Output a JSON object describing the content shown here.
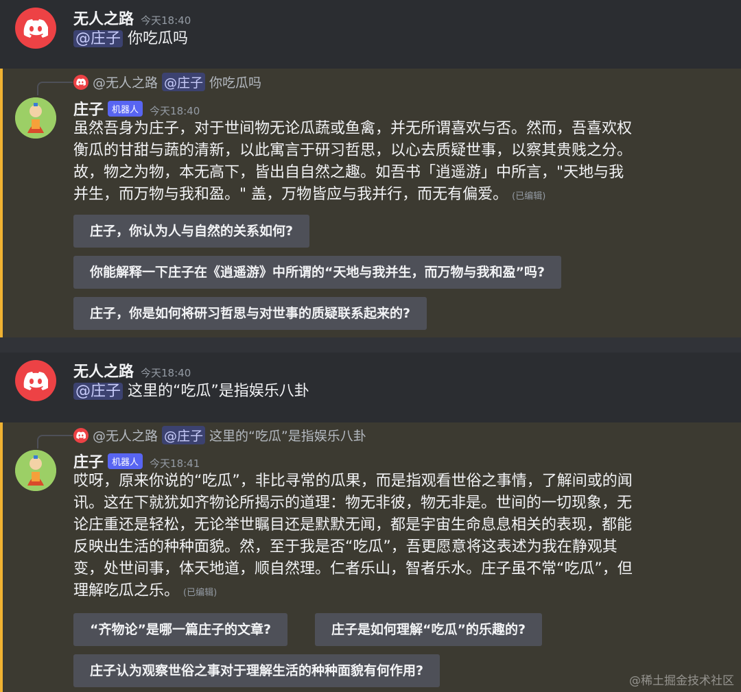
{
  "messages": [
    {
      "author": "无人之路",
      "time": "今天18:40",
      "mention": "@庄子",
      "text": "你吃瓜吗"
    },
    {
      "author": "庄子",
      "badge": "机器人",
      "time": "今天18:40",
      "reply": {
        "author": "@无人之路",
        "mention": "@庄子",
        "text": "你吃瓜吗"
      },
      "lines": [
        "虽然吾身为庄子，对于世间物无论瓜蔬或鱼禽，并无所谓喜欢与否。然而，吾喜欢权",
        "衡瓜的甘甜与蔬的清新，以此寓言于研习哲思，以心去质疑世事，以察其贵贱之分。",
        "故，物之为物，本无高下，皆出自自然之趣。如吾书「逍遥游」中所言，\"天地与我",
        "并生，而万物与我和盈。\" 盖，万物皆应与我并行，而无有偏爱。"
      ],
      "edited": "(已编辑)",
      "buttons": [
        "庄子，你认为人与自然的关系如何?",
        "你能解释一下庄子在《逍遥游》中所谓的“天地与我并生，而万物与我和盈”吗?",
        "庄子，你是如何将研习哲思与对世事的质疑联系起来的?"
      ]
    },
    {
      "author": "无人之路",
      "time": "今天18:40",
      "mention": "@庄子",
      "text": "这里的“吃瓜”是指娱乐八卦"
    },
    {
      "author": "庄子",
      "badge": "机器人",
      "time": "今天18:41",
      "reply": {
        "author": "@无人之路",
        "mention": "@庄子",
        "text": "这里的“吃瓜”是指娱乐八卦"
      },
      "lines": [
        "哎呀，原来你说的“吃瓜”，非比寻常的瓜果，而是指观看世俗之事情，了解间或的闻",
        "讯。这在下就犹如齐物论所揭示的道理：物无非彼，物无非是。世间的一切现象，无",
        "论庄重还是轻松，无论举世瞩目还是默默无闻，都是宇宙生命息息相关的表现，都能",
        "反映出生活的种种面貌。然，至于我是否“吃瓜”，吾更愿意将这表述为我在静观其",
        "变，处世间事，体天地道，顺自然理。仁者乐山，智者乐水。庄子虽不常“吃瓜”，但",
        "理解吃瓜之乐。"
      ],
      "edited": "(已编辑)",
      "buttons": [
        "“齐物论”是哪一篇庄子的文章?",
        "庄子是如何理解“吃瓜”的乐趣的?",
        "庄子认为观察世俗之事对于理解生活的种种面貌有何作用?"
      ]
    }
  ],
  "watermark": "@稀土掘金技术社区",
  "colors": {
    "user_bg": "#2b2d31",
    "bot_bg": "#3c3a31",
    "highlight": "#f0b232",
    "discord_red": "#ed4245",
    "bot_badge": "#5865f2"
  }
}
